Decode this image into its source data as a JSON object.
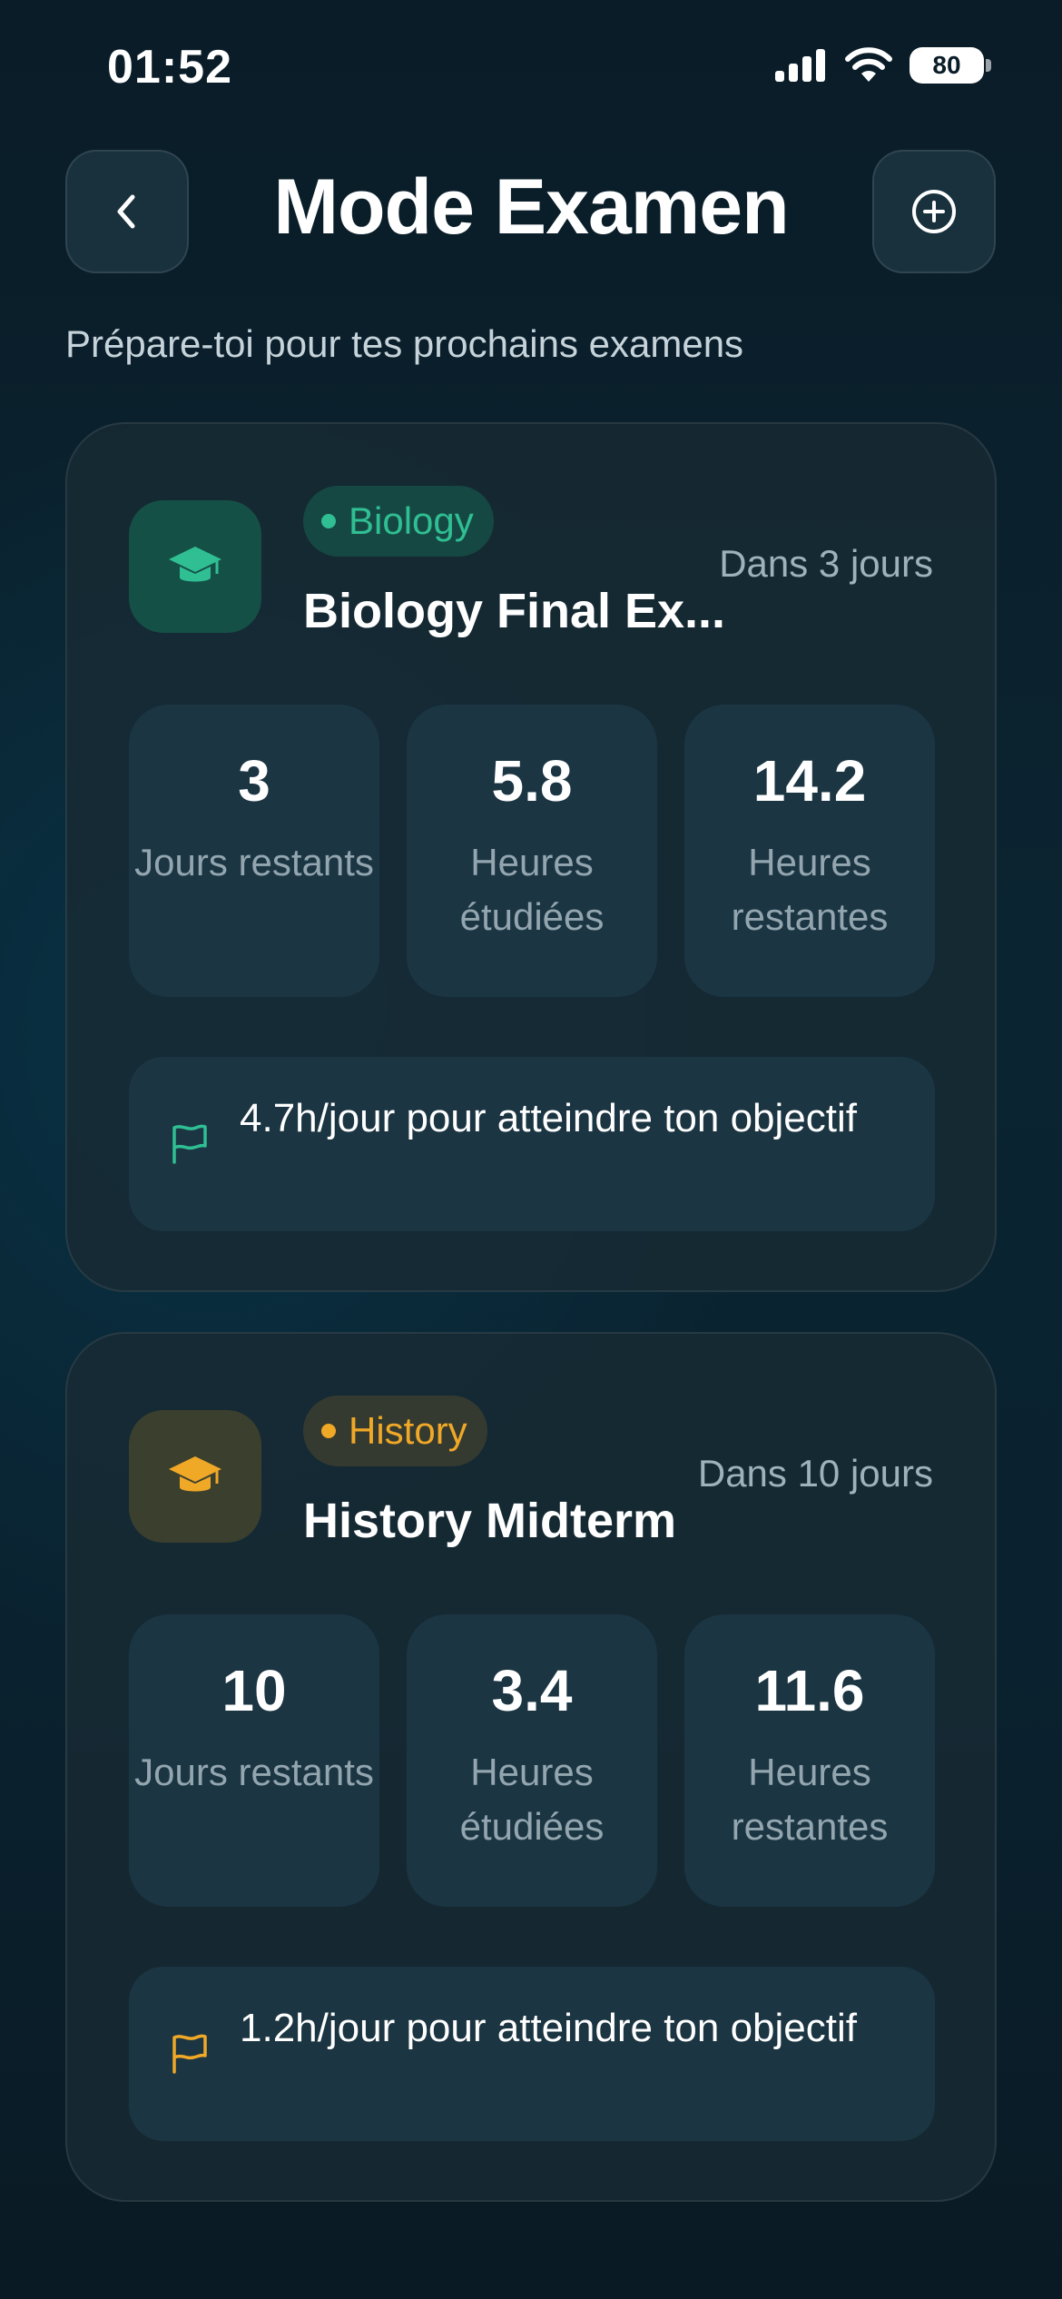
{
  "status_bar": {
    "time": "01:52",
    "battery": "80"
  },
  "header": {
    "title": "Mode Examen",
    "subtitle": "Prépare-toi pour tes prochains examens"
  },
  "exams": [
    {
      "subject": "Biology",
      "title": "Biology Final Ex...",
      "countdown": "Dans 3 jours",
      "accent_color": "#2fbf93",
      "stats": [
        {
          "value": "3",
          "label": "Jours restants"
        },
        {
          "value": "5.8",
          "label": "Heures étudiées"
        },
        {
          "value": "14.2",
          "label": "Heures restantes"
        }
      ],
      "goal": "4.7h/jour pour atteindre ton objectif"
    },
    {
      "subject": "History",
      "title": "History Midterm",
      "countdown": "Dans 10 jours",
      "accent_color": "#f0a827",
      "stats": [
        {
          "value": "10",
          "label": "Jours restants"
        },
        {
          "value": "3.4",
          "label": "Heures étudiées"
        },
        {
          "value": "11.6",
          "label": "Heures restantes"
        }
      ],
      "goal": "1.2h/jour pour atteindre ton objectif"
    }
  ],
  "icons": {
    "back": "chevron-left-icon",
    "add": "plus-circle-icon",
    "subject": "graduation-cap-icon",
    "goal": "flag-icon"
  }
}
